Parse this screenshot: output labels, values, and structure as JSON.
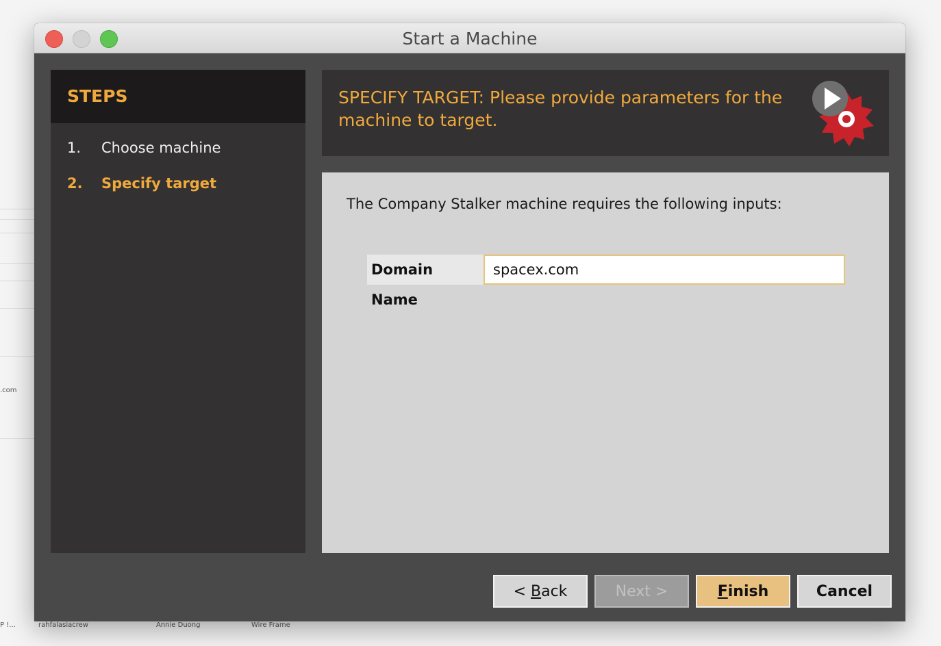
{
  "window": {
    "title": "Start a Machine"
  },
  "steps": {
    "title": "STEPS",
    "items": [
      {
        "num": "1.",
        "label": "Choose machine"
      },
      {
        "num": "2.",
        "label": "Specify target"
      }
    ]
  },
  "header": {
    "text": "SPECIFY TARGET: Please provide parameters for the machine to target."
  },
  "content": {
    "intro": "The Company Stalker machine requires the following inputs:",
    "field": {
      "label": "Domain Name",
      "value": "spacex.com"
    }
  },
  "buttons": {
    "back_prefix": "< ",
    "back_mnemonic": "B",
    "back_rest": "ack",
    "next": "Next >",
    "finish_mnemonic": "F",
    "finish_rest": "inish",
    "cancel": "Cancel"
  },
  "desktop": {
    "labels": [
      "P !...",
      "rahfalasiacrew",
      "Annie Duong",
      "Wire Frame",
      ".com"
    ]
  },
  "colors": {
    "accent": "#f0a93c",
    "finish": "#e8c07f",
    "panel_dark": "#333132"
  }
}
